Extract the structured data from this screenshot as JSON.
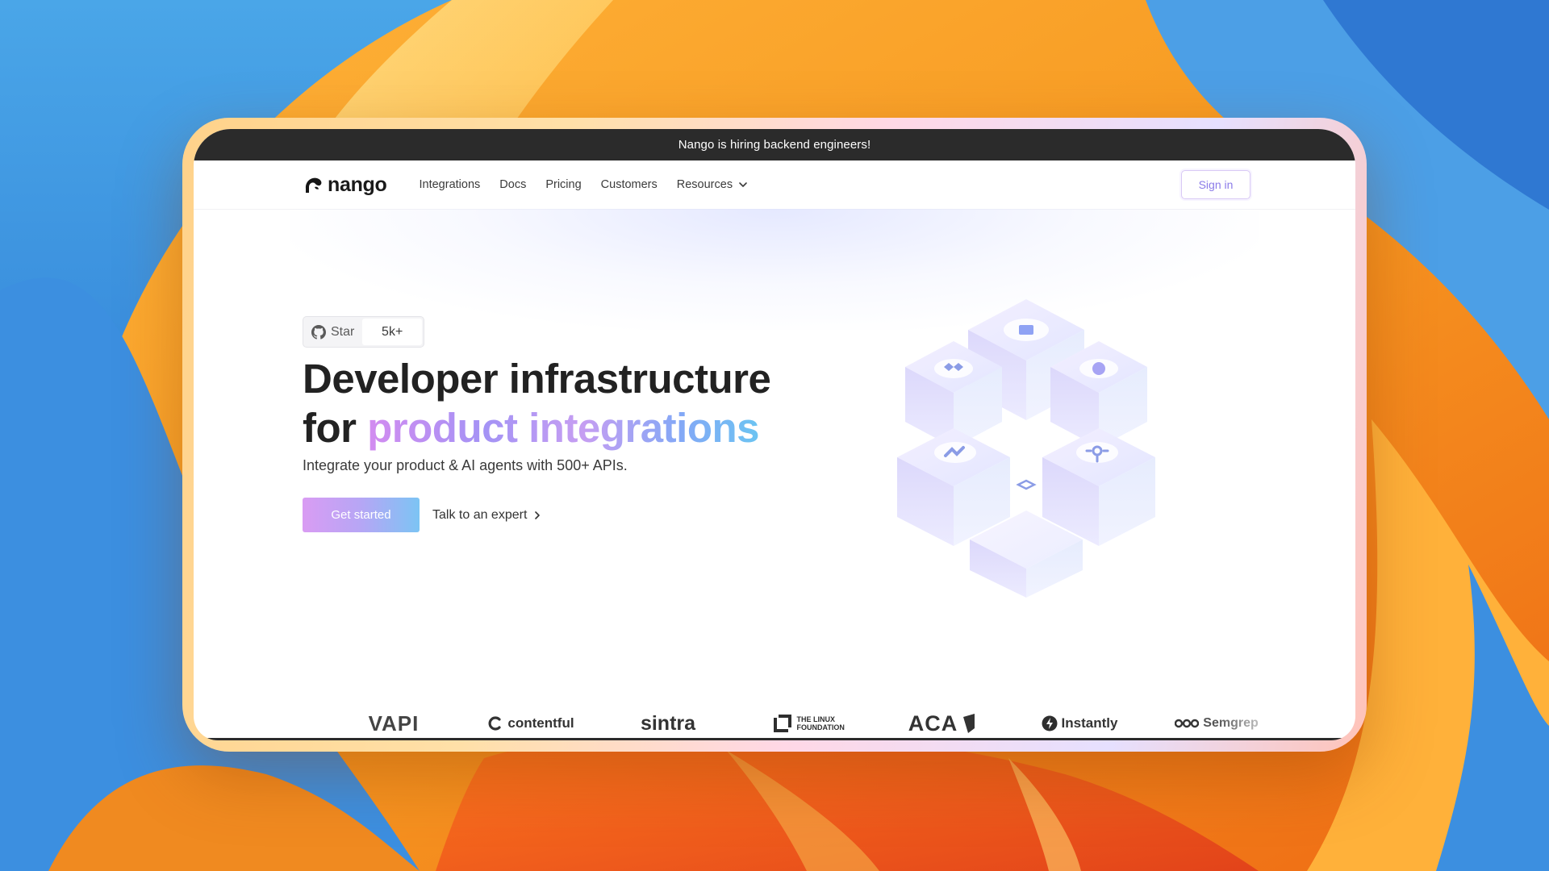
{
  "announcement": {
    "text": "Nango is hiring backend engineers!"
  },
  "nav": {
    "brand": "nango",
    "links": [
      {
        "label": "Integrations"
      },
      {
        "label": "Docs"
      },
      {
        "label": "Pricing"
      },
      {
        "label": "Customers"
      },
      {
        "label": "Resources",
        "has_dropdown": true
      }
    ],
    "sign_in": "Sign in"
  },
  "hero": {
    "github": {
      "label": "Star",
      "count": "5k+",
      "icon": "github-icon"
    },
    "headline_line1": "Developer infrastructure",
    "headline_for": "for",
    "headline_highlight": "product integrations",
    "subheadline": "Integrate your product & AI agents with 500+ APIs.",
    "cta_primary": "Get started",
    "cta_secondary": "Talk to an expert",
    "gradient_colors": [
      "#d38cf0",
      "#a493f5",
      "#83a8f6",
      "#6cc4f2"
    ]
  },
  "customer_logos": [
    {
      "name": "VAPI"
    },
    {
      "name": "contentful"
    },
    {
      "name": "sintra"
    },
    {
      "name": "THE LINUX FOUNDATION"
    },
    {
      "name": "ACA"
    },
    {
      "name": "Instantly"
    },
    {
      "name": "Semgrep"
    }
  ],
  "colors": {
    "announcement_bg": "#2b2b2b",
    "text_primary": "#222222",
    "sign_in_text": "#8b7be8"
  }
}
